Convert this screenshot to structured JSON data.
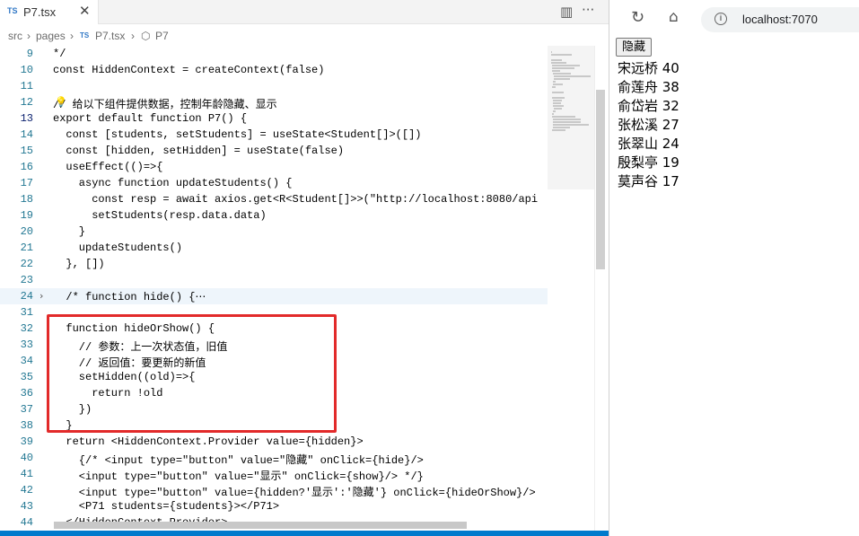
{
  "editor": {
    "tab": {
      "lang_badge": "TS",
      "filename": "P7.tsx",
      "close": "✕"
    },
    "toolbar_icons": {
      "split": "▥",
      "more": "···"
    },
    "breadcrumb": {
      "src": "src",
      "pages": "pages",
      "file_badge": "TS",
      "file": "P7.tsx",
      "symbol": "P7"
    },
    "code_lines": [
      {
        "n": "9",
        "text": "*/"
      },
      {
        "n": "10",
        "text": "const HiddenContext = createContext(false)"
      },
      {
        "n": "11",
        "text": ""
      },
      {
        "n": "12",
        "text": "// 给以下组件提供数据，控制年龄隐藏、显示"
      },
      {
        "n": "13",
        "text": "export default function P7() {"
      },
      {
        "n": "14",
        "text": "  const [students, setStudents] = useState<Student[]>([])"
      },
      {
        "n": "15",
        "text": "  const [hidden, setHidden] = useState(false)"
      },
      {
        "n": "16",
        "text": "  useEffect(()=>{"
      },
      {
        "n": "17",
        "text": "    async function updateStudents() {"
      },
      {
        "n": "18",
        "text": "      const resp = await axios.get<R<Student[]>>(\"http://localhost:8080/api"
      },
      {
        "n": "19",
        "text": "      setStudents(resp.data.data)"
      },
      {
        "n": "20",
        "text": "    }"
      },
      {
        "n": "21",
        "text": "    updateStudents()"
      },
      {
        "n": "22",
        "text": "  }, [])"
      },
      {
        "n": "23",
        "text": ""
      },
      {
        "n": "24",
        "text": "  /* function hide() {⋯"
      },
      {
        "n": "31",
        "text": ""
      },
      {
        "n": "32",
        "text": "  function hideOrShow() {"
      },
      {
        "n": "33",
        "text": "    // 参数：上一次状态值，旧值"
      },
      {
        "n": "34",
        "text": "    // 返回值：要更新的新值"
      },
      {
        "n": "35",
        "text": "    setHidden((old)=>{"
      },
      {
        "n": "36",
        "text": "      return !old"
      },
      {
        "n": "37",
        "text": "    })"
      },
      {
        "n": "38",
        "text": "  }"
      },
      {
        "n": "39",
        "text": "  return <HiddenContext.Provider value={hidden}>"
      },
      {
        "n": "40",
        "text": "    {/* <input type=\"button\" value=\"隐藏\" onClick={hide}/>"
      },
      {
        "n": "41",
        "text": "    <input type=\"button\" value=\"显示\" onClick={show}/> */}"
      },
      {
        "n": "42",
        "text": "    <input type=\"button\" value={hidden?'显示':'隐藏'} onClick={hideOrShow}/>"
      },
      {
        "n": "43",
        "text": "    <P71 students={students}></P71>"
      },
      {
        "n": "44",
        "text": "  </HiddenContext.Provider>"
      }
    ]
  },
  "browser": {
    "reload_icon": "↻",
    "home_icon": "⌂",
    "info_icon": "i",
    "url": "localhost:7070",
    "hide_button_label": "隐藏",
    "students": [
      "宋远桥 40",
      "俞莲舟 38",
      "俞岱岩 32",
      "张松溪 27",
      "张翠山 24",
      "殷梨亭 19",
      "莫声谷 17"
    ]
  }
}
